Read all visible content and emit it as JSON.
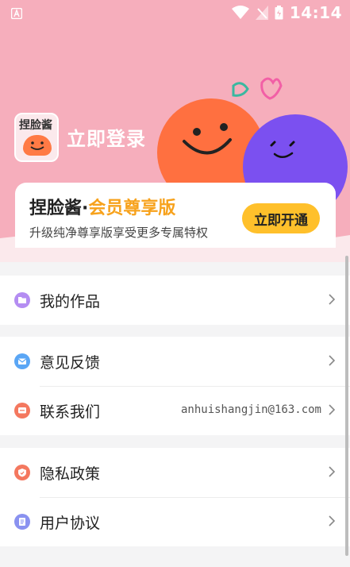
{
  "status_bar": {
    "time": "14:14"
  },
  "profile": {
    "avatar_text": "捏脸酱",
    "login_label": "立即登录"
  },
  "member_card": {
    "brand": "捏脸酱",
    "separator": "·",
    "vip_label": "会员尊享版",
    "subtitle": "升级纯净尊享版享受更多专属特权",
    "button_label": "立即开通"
  },
  "menu": {
    "works": {
      "label": "我的作品",
      "icon": "folder-icon",
      "color": "#b48df2"
    },
    "feedback": {
      "label": "意见反馈",
      "icon": "mail-icon",
      "color": "#5aa6f5"
    },
    "contact": {
      "label": "联系我们",
      "value": "anhuishangjin@163.com",
      "icon": "chat-icon",
      "color": "#f4785f"
    },
    "privacy": {
      "label": "隐私政策",
      "icon": "shield-icon",
      "color": "#f4785f"
    },
    "agreement": {
      "label": "用户协议",
      "icon": "document-icon",
      "color": "#8a92f0"
    }
  },
  "colors": {
    "header_bg": "#f6aebc",
    "accent": "#ffc02b",
    "vip": "#f7a21c"
  }
}
